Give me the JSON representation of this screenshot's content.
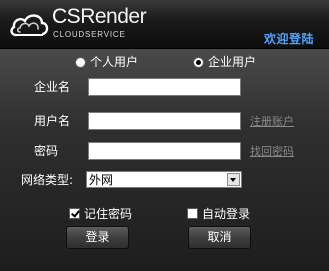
{
  "brand": {
    "title_prefix": "CS",
    "title_suffix": "Render",
    "subtitle": "CLOUDSERVICE"
  },
  "header": {
    "welcome": "欢迎登陆"
  },
  "account_type": {
    "options": [
      {
        "label": "个人用户",
        "selected": false
      },
      {
        "label": "企业用户",
        "selected": true
      }
    ]
  },
  "fields": {
    "company": {
      "label": "企业名",
      "value": ""
    },
    "username": {
      "label": "用户名",
      "value": "",
      "link": "注册账户"
    },
    "password": {
      "label": "密码",
      "value": "",
      "link": "找回密码"
    },
    "network": {
      "label": "网络类型:",
      "selected": "外网"
    }
  },
  "options": {
    "remember": {
      "label": "记住密码",
      "checked": true
    },
    "autologin": {
      "label": "自动登录",
      "checked": false
    }
  },
  "buttons": {
    "login": "登录",
    "cancel": "取消"
  },
  "colors": {
    "welcome": "#4da3ff",
    "link": "#8a8a8a",
    "background": "#1a1a1a"
  }
}
